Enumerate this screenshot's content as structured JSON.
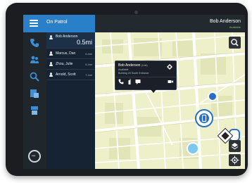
{
  "header": {
    "title": "On Patrol",
    "user_name": "Bob Anderson",
    "user_status": "Available"
  },
  "rail": {
    "icons": [
      "phone-icon",
      "group-icon",
      "search-icon",
      "report-icon",
      "device-icon"
    ]
  },
  "list": {
    "items": [
      {
        "name": "Bob Anderson",
        "distance": "0.5mi"
      },
      {
        "name": "Marcus, Dan",
        "distance": "6.4mi"
      },
      {
        "name": "Zhou, Julie",
        "distance": "6.4mi"
      },
      {
        "name": "Arnold, Scott",
        "distance": "7.4mi"
      }
    ]
  },
  "popup": {
    "name": "Bob Anderson",
    "name_tag": "(Unit)",
    "status": "Available",
    "location": "Building 20 South Entrance"
  },
  "colors": {
    "accent": "#2a7fc9",
    "sidebar": "#152333",
    "map_bg": "#eef0c9",
    "status_available": "#7fc36b"
  }
}
